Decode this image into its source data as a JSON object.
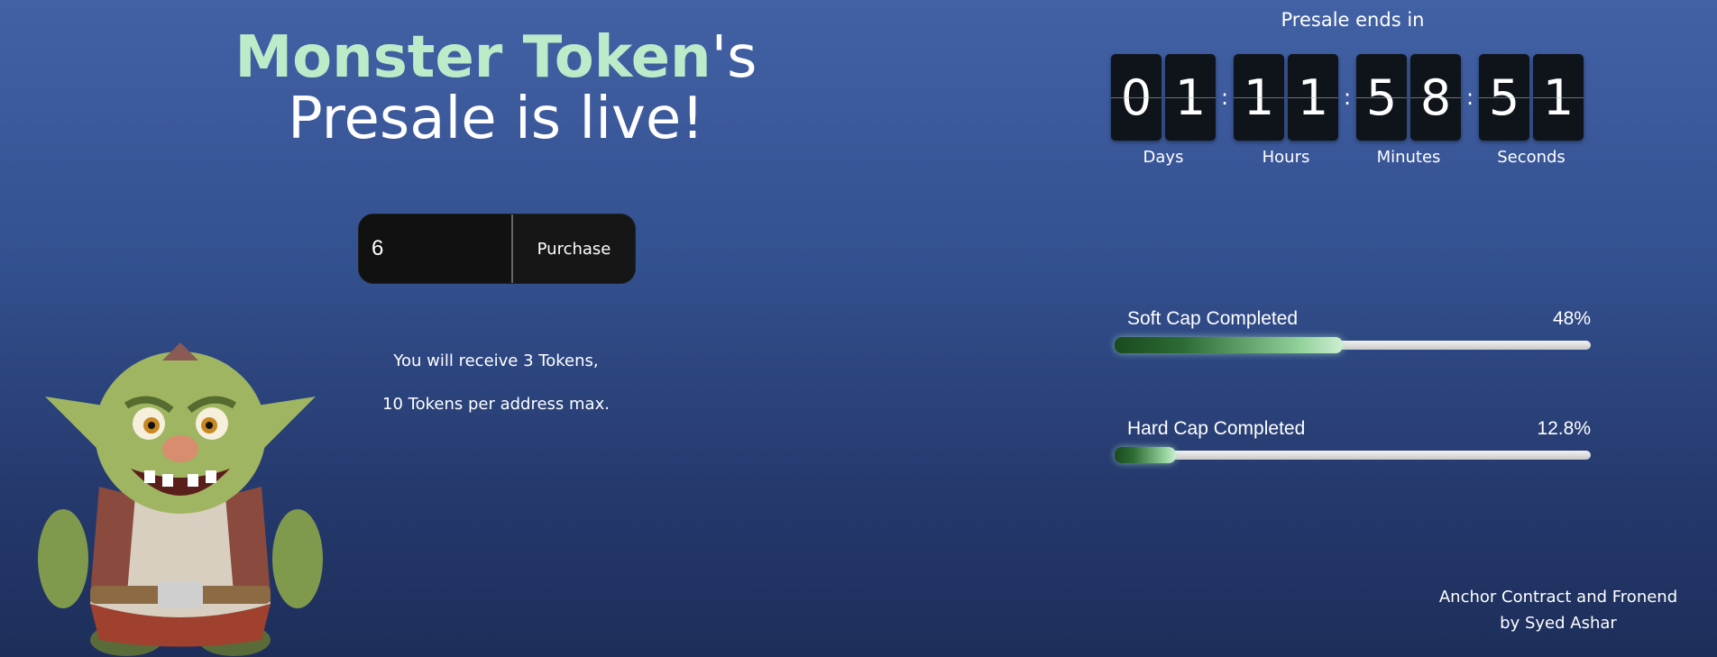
{
  "header": {
    "brand": "Monster Token",
    "possessive": "'s",
    "subtitle": "Presale is live!"
  },
  "purchase": {
    "amount_value": "6",
    "button_label": "Purchase"
  },
  "info": {
    "receive_text": "You will receive 3 Tokens,",
    "max_text": "10 Tokens per address max."
  },
  "countdown": {
    "title": "Presale ends in",
    "units": [
      {
        "label": "Days",
        "digits": [
          "0",
          "1"
        ]
      },
      {
        "label": "Hours",
        "digits": [
          "1",
          "1"
        ]
      },
      {
        "label": "Minutes",
        "digits": [
          "5",
          "8"
        ]
      },
      {
        "label": "Seconds",
        "digits": [
          "5",
          "1"
        ]
      }
    ],
    "separator": ":"
  },
  "progress": [
    {
      "label": "Soft Cap Completed",
      "value_text": "48%",
      "fraction": 0.48
    },
    {
      "label": "Hard Cap Completed",
      "value_text": "12.8%",
      "fraction": 0.128
    }
  ],
  "footer": {
    "credit_line1": "Anchor Contract and Fronend",
    "credit_line2": "by Syed Ashar"
  },
  "colors": {
    "brand_green": "#bdebc9",
    "progress_green": "#2c6b33"
  },
  "icons": {
    "mascot": "goblin-mascot-icon"
  }
}
